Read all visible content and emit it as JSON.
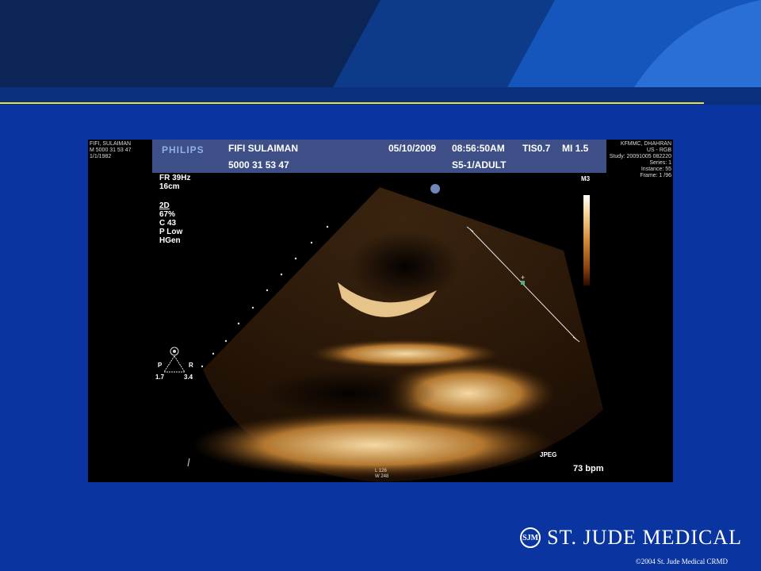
{
  "colors": {
    "slide_background": "#0a35a0",
    "header_dark": "#0b2656",
    "header_mid": "#0e3a8a",
    "header_light": "#2a6fd6",
    "accent_rule": "#e8e23a",
    "banner": "#3d4f86"
  },
  "ultrasound": {
    "top_left_info": [
      "FIFI, SULAIMAN",
      "M 5000  31 53 47",
      "1/1/1982"
    ],
    "top_right_info": [
      "KFMMC, DHAHRAN",
      "US - RGB",
      "Study: 20091005 082220",
      "Series: 1",
      "Instance: 55",
      "Frame: 1 /96"
    ],
    "banner": {
      "logo": "PHILIPS",
      "patient_name": "FIFI SULAIMAN",
      "patient_id": "5000  31 53 47",
      "date": "05/10/2009",
      "time": "08:56:50AM",
      "tis": "TIS0.7",
      "mi": "MI 1.5",
      "probe": "S5-1/ADULT"
    },
    "params": [
      "FR 39Hz",
      "16cm"
    ],
    "mode_params": [
      "2D",
      " 67%",
      "C 43",
      "P Low",
      "HGen"
    ],
    "map_label": "M3",
    "orientation": {
      "left": "P",
      "right": "R",
      "left_value": "1.7",
      "right_value": "3.4"
    },
    "jpeg_label": "JPEG",
    "heart_rate": "73 bpm",
    "bottom_center": [
      "L 126",
      "W 248"
    ]
  },
  "footer": {
    "logo_mark": "SJM",
    "company_name": "ST. JUDE MEDICAL",
    "copyright": "©2004 St. Jude Medical CRMD"
  }
}
